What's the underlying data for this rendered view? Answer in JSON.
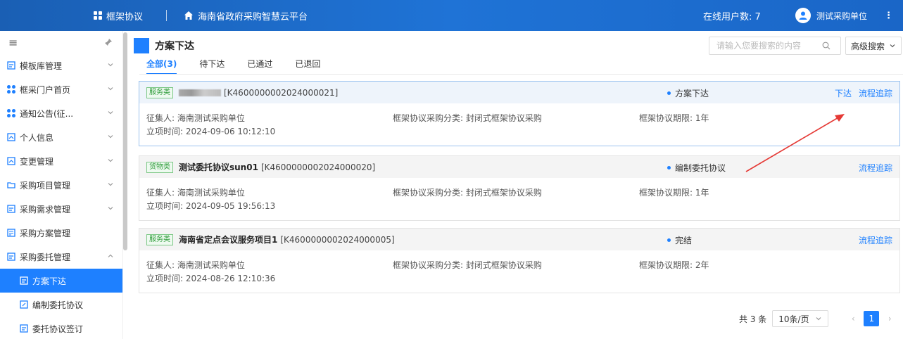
{
  "header": {
    "module_label": "框架协议",
    "platform_label": "海南省政府采购智慧云平台",
    "online_users": "在线用户数: 7",
    "user_name": "测试采购单位"
  },
  "sidebar": {
    "items": [
      {
        "label": "模板库管理"
      },
      {
        "label": "框采门户首页"
      },
      {
        "label": "通知公告(征..."
      },
      {
        "label": "个人信息"
      },
      {
        "label": "变更管理"
      },
      {
        "label": "采购项目管理"
      },
      {
        "label": "采购需求管理"
      },
      {
        "label": "采购方案管理"
      },
      {
        "label": "采购委托管理"
      }
    ],
    "sub_items": [
      {
        "label": "方案下达"
      },
      {
        "label": "编制委托协议"
      },
      {
        "label": "委托协议签订"
      }
    ]
  },
  "main": {
    "title": "方案下达",
    "search_placeholder": "请输入您要搜索的内容",
    "advanced_search": "高级搜索",
    "tabs": [
      {
        "label": "全部(3)"
      },
      {
        "label": "待下达"
      },
      {
        "label": "已通过"
      },
      {
        "label": "已退回"
      }
    ],
    "records": [
      {
        "tag": "服务类",
        "name": "",
        "code": "[K4600000002024000021]",
        "status": "方案下达",
        "actions": [
          "下达",
          "流程追踪"
        ],
        "collector": "征集人: 海南测试采购单位",
        "category": "框架协议采购分类: 封闭式框架协议采购",
        "term": "框架协议期限: 1年",
        "created": "立项时间: 2024-09-06 10:12:10"
      },
      {
        "tag": "货物类",
        "name": "测试委托协议sun01",
        "code": "[K4600000002024000020]",
        "status": "编制委托协议",
        "actions": [
          "流程追踪"
        ],
        "collector": "征集人: 海南测试采购单位",
        "category": "框架协议采购分类: 封闭式框架协议采购",
        "term": "框架协议期限: 1年",
        "created": "立项时间: 2024-09-05 19:56:13"
      },
      {
        "tag": "服务类",
        "name": "海南省定点会议服务项目1",
        "code": "[K4600000002024000005]",
        "status": "完结",
        "actions": [
          "流程追踪"
        ],
        "collector": "征集人: 海南测试采购单位",
        "category": "框架协议采购分类: 封闭式框架协议采购",
        "term": "框架协议期限: 2年",
        "created": "立项时间: 2024-08-26 12:10:36"
      }
    ],
    "pagination": {
      "total": "共 3 条",
      "page_size": "10条/页",
      "current_page": "1"
    }
  },
  "colors": {
    "primary": "#1e80ff",
    "header_bg": "#1a66c7",
    "tag_green": "#2f9c3a",
    "annotation_red": "#e53935"
  }
}
